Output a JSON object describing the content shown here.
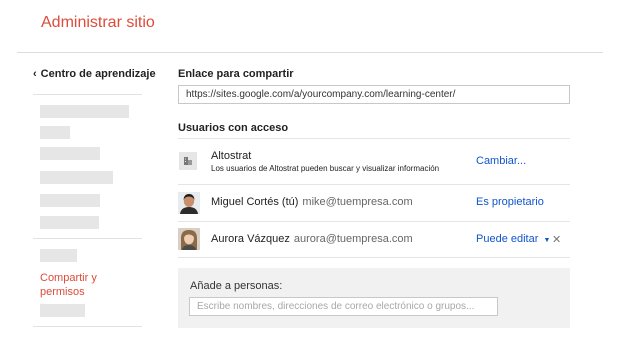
{
  "header": {
    "title": "Administrar sitio"
  },
  "sidebar": {
    "back_label": "Centro de aprendizaje",
    "active_item": "Compartir y permisos"
  },
  "share_link": {
    "heading": "Enlace para compartir",
    "url": "https://sites.google.com/a/yourcompany.com/learning-center/"
  },
  "access": {
    "heading": "Usuarios con acceso",
    "organization": {
      "icon": "building-icon",
      "name": "Altostrat",
      "description": "Los usuarios de Altostrat pueden buscar y visualizar información",
      "action": "Cambiar..."
    },
    "users": [
      {
        "name": "Miguel Cortés (tú)",
        "email": "mike@tuempresa.com",
        "role": "Es propietario"
      },
      {
        "name": "Aurora Vázquez",
        "email": "aurora@tuempresa.com",
        "role": "Puede editar"
      }
    ]
  },
  "add_people": {
    "label": "Añade a personas:",
    "placeholder": "Escribe nombres, direcciones de correo electrónico o grupos..."
  },
  "colors": {
    "accent": "#dd4b39",
    "link": "#1155cc",
    "panel": "#f1f1f1",
    "placeholder_block": "#e6e6e6"
  }
}
